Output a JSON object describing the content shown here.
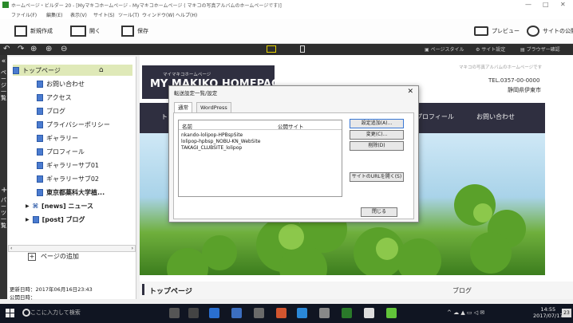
{
  "window": {
    "title": "ホームページ・ビルダー 20 - [Myマキコホームページ - Myマキコホームページ ( マキコの写真アルバムのホームページです)]",
    "controls": [
      "—",
      "□",
      "✕"
    ]
  },
  "menu": [
    "ファイル(F)",
    "編集(E)",
    "表示(V)",
    "サイト(S)",
    "ツール(T)",
    "ウィンドウ(W)",
    "ヘルプ(H)"
  ],
  "toolbar": {
    "new_label": "新規作成",
    "open_label": "開く",
    "save_label": "保存",
    "preview_label": "プレビュー",
    "publish_label": "サイトの公開"
  },
  "darkbar": {
    "page_style": "ページスタイル",
    "site_settings": "サイト設定",
    "browser_check": "ブラウザー確認"
  },
  "vstrip": {
    "top_text": "ページ一覧",
    "bottom_text": "パーツ一覧"
  },
  "sidebar": {
    "root": "トップページ",
    "items": [
      "お問い合わせ",
      "アクセス",
      "ブログ",
      "プライバシーポリシー",
      "ギャラリー",
      "プロフィール",
      "ギャラリーサブ01",
      "ギャラリーサブ02",
      "東京都薬科大学植..."
    ],
    "folders": [
      "[news] ニュース",
      "[post] ブログ"
    ],
    "add_page": "ページの追加",
    "updated": "更新日時：2017年06月16日23:43",
    "published": "公開日時："
  },
  "page": {
    "small_title": "マイマキコホームページ",
    "big_title": "MY MAKIKO HOMEPAGE",
    "tagline": "マキコの写真アルバムのホームページです",
    "tel": "TEL.0357-00-0000",
    "address": "静岡県伊東市",
    "nav": [
      "トップ",
      "プロフィール",
      "お問い合わせ"
    ],
    "section_title": "トップページ",
    "blog_label": "ブログ"
  },
  "dialog": {
    "title": "転送設定一覧/設定",
    "tabs": [
      "通常",
      "WordPress"
    ],
    "col_name": "名前",
    "col_site": "公開サイト",
    "rows": [
      "nkando-lolipop-HPBspSite",
      "lolipop-hpbsp_NOBU-KN_WebSite",
      "TAKAGI_CLUBSITE_lolipop"
    ],
    "btn_add": "設定追加(A)...",
    "btn_change": "変更(C)...",
    "btn_delete": "削除(D)",
    "btn_open_url": "サイトのURLを開く(S)",
    "btn_close": "閉じる"
  },
  "taskbar": {
    "search_placeholder": "ここに入力して検索",
    "time": "14:55",
    "date": "2017/07/17",
    "notif": "23"
  }
}
